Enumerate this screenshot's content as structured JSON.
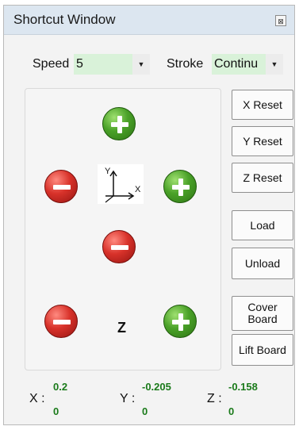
{
  "window": {
    "title": "Shortcut Window",
    "close_symbol": "⊠"
  },
  "speed": {
    "label": "Speed",
    "value": "5"
  },
  "stroke": {
    "label": "Stroke",
    "value": "Continu"
  },
  "pad": {
    "axis_y": "Y",
    "axis_x": "X",
    "z_label": "Z"
  },
  "buttons": {
    "x_reset": "X Reset",
    "y_reset": "Y Reset",
    "z_reset": "Z Reset",
    "load": "Load",
    "unload": "Unload",
    "cover_board_line1": "Cover",
    "cover_board_line2": "Board",
    "lift_board": "Lift Board"
  },
  "status": {
    "x_label": "X :",
    "x_top": "0.2",
    "x_bottom": "0",
    "y_label": "Y :",
    "y_top": "-0.205",
    "y_bottom": "0",
    "z_label": "Z :",
    "z_top": "-0.158",
    "z_bottom": "0"
  },
  "colors": {
    "combo_bg": "#d9f2d9",
    "plus": "#4aa128",
    "minus": "#d8322a",
    "values": "#1a7a1a"
  }
}
